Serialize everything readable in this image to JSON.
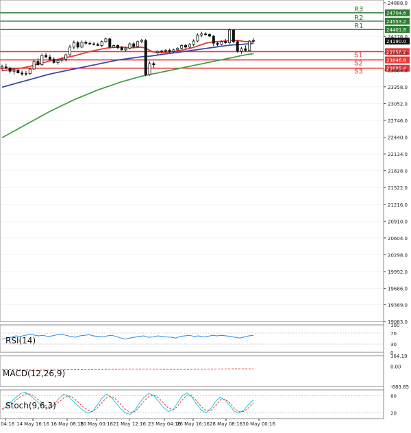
{
  "chart_data": [
    {
      "type": "candlestick",
      "panel": "price",
      "y_ticks": [
        24888.0,
        24276.0,
        23970.0,
        23664.0,
        23358.0,
        23052.0,
        22746.0,
        22440.0,
        22134.0,
        21828.0,
        21522.0,
        21216.0,
        20910.0,
        20604.0,
        20298.0,
        19992.0,
        19686.0,
        19389.0,
        19083.0
      ],
      "ylim": [
        19083.0,
        24888.0
      ],
      "x_tick_labels": [
        "y 04:16",
        "14 May 16:16",
        "16 May 08:16",
        "20 May 00:16",
        "21 May 12:16",
        "23 May 04:16",
        "26 May 16:16",
        "28 May 08:16",
        "30 May 00:16"
      ],
      "current_price": "24190.0",
      "resistance_levels": [
        {
          "label": "R3",
          "value": 24704.6,
          "text": "24704.6"
        },
        {
          "label": "R2",
          "value": 24553.2,
          "text": "24553.2"
        },
        {
          "label": "R1",
          "value": 24401.8,
          "text": "24401.8"
        }
      ],
      "support_levels": [
        {
          "label": "S1",
          "value": 23998.2,
          "text": "23998.2"
        },
        {
          "label": "S2",
          "value": 23846.8,
          "text": "23846.8"
        },
        {
          "label": "S3",
          "value": 23695.4,
          "text": "23695.4"
        }
      ],
      "candles": [
        [
          23700,
          23760,
          23650,
          23720
        ],
        [
          23720,
          23780,
          23680,
          23700
        ],
        [
          23700,
          23720,
          23600,
          23640
        ],
        [
          23640,
          23700,
          23580,
          23660
        ],
        [
          23660,
          23690,
          23600,
          23610
        ],
        [
          23610,
          23650,
          23560,
          23590
        ],
        [
          23590,
          23640,
          23560,
          23600
        ],
        [
          23600,
          23700,
          23580,
          23680
        ],
        [
          23680,
          23860,
          23660,
          23820
        ],
        [
          23820,
          23880,
          23740,
          23760
        ],
        [
          23760,
          23960,
          23740,
          23930
        ],
        [
          23930,
          23970,
          23880,
          23900
        ],
        [
          23900,
          23940,
          23840,
          23860
        ],
        [
          23860,
          23900,
          23780,
          23800
        ],
        [
          23800,
          23860,
          23760,
          23840
        ],
        [
          23840,
          23900,
          23800,
          23860
        ],
        [
          23860,
          23960,
          23820,
          23940
        ],
        [
          23940,
          24120,
          23920,
          24080
        ],
        [
          24080,
          24200,
          24040,
          24160
        ],
        [
          24160,
          24190,
          24050,
          24080
        ],
        [
          24080,
          24200,
          24060,
          24170
        ],
        [
          24170,
          24200,
          24120,
          24150
        ],
        [
          24150,
          24180,
          24120,
          24140
        ],
        [
          24140,
          24170,
          24110,
          24130
        ],
        [
          24130,
          24160,
          24100,
          24110
        ],
        [
          24110,
          24200,
          24080,
          24180
        ],
        [
          24180,
          24250,
          24160,
          24230
        ],
        [
          24230,
          24250,
          24050,
          24080
        ],
        [
          24080,
          24130,
          24060,
          24110
        ],
        [
          24110,
          24130,
          24040,
          24070
        ],
        [
          24070,
          24100,
          24020,
          24030
        ],
        [
          24030,
          24080,
          24000,
          24060
        ],
        [
          24060,
          24160,
          24040,
          24140
        ],
        [
          24140,
          24170,
          24060,
          24090
        ],
        [
          24090,
          24200,
          24070,
          24180
        ],
        [
          24180,
          24230,
          24150,
          24200
        ],
        [
          24200,
          24230,
          23550,
          23580
        ],
        [
          23580,
          23820,
          23560,
          23780
        ],
        [
          23780,
          23820,
          23700,
          23760
        ],
        [
          23980,
          24020,
          23940,
          24000
        ],
        [
          24000,
          24030,
          23970,
          24010
        ],
        [
          24010,
          24040,
          23980,
          24020
        ],
        [
          24020,
          24050,
          23980,
          24000
        ],
        [
          24000,
          24050,
          23980,
          24030
        ],
        [
          24030,
          24080,
          24000,
          24060
        ],
        [
          24060,
          24130,
          24040,
          24110
        ],
        [
          24110,
          24140,
          24050,
          24080
        ],
        [
          24080,
          24150,
          24060,
          24130
        ],
        [
          24130,
          24220,
          24100,
          24190
        ],
        [
          24190,
          24330,
          24170,
          24300
        ],
        [
          24300,
          24360,
          24260,
          24320
        ],
        [
          24320,
          24350,
          24290,
          24310
        ],
        [
          24310,
          24330,
          24260,
          24280
        ],
        [
          24280,
          24300,
          24100,
          24150
        ],
        [
          24150,
          24180,
          24100,
          24130
        ],
        [
          24130,
          24200,
          24110,
          24180
        ],
        [
          24180,
          24230,
          24140,
          24160
        ],
        [
          24160,
          24420,
          24140,
          24390
        ],
        [
          24390,
          24400,
          24150,
          24180
        ],
        [
          24180,
          24210,
          23980,
          24010
        ],
        [
          24010,
          24080,
          23960,
          24050
        ],
        [
          24050,
          24110,
          24000,
          24020
        ],
        [
          24020,
          24210,
          24000,
          24190
        ],
        [
          24190,
          24240,
          24160,
          24200
        ]
      ],
      "moving_averages": [
        {
          "color": "#e53935",
          "values": [
            23650,
            23660,
            23670,
            23680,
            23690,
            23700,
            23715,
            23730,
            23750,
            23770,
            23790,
            23810,
            23830,
            23845,
            23860,
            23875,
            23890,
            23905,
            23920,
            23940,
            23960,
            23980,
            24000,
            24015,
            24030,
            24045,
            24060,
            24070,
            24075,
            24080,
            24080,
            24075,
            24070,
            24070,
            24075,
            24080,
            24060,
            24020,
            23990,
            23980,
            23980,
            23985,
            23990,
            24000,
            24010,
            24025,
            24040,
            24055,
            24075,
            24100,
            24125,
            24150,
            24165,
            24175,
            24180,
            24185,
            24190,
            24200,
            24205,
            24200,
            24190,
            24180,
            24175,
            24175
          ]
        },
        {
          "color": "#3949ab",
          "values": [
            23350,
            23370,
            23390,
            23410,
            23430,
            23450,
            23470,
            23490,
            23510,
            23530,
            23550,
            23570,
            23590,
            23605,
            23620,
            23635,
            23650,
            23665,
            23680,
            23695,
            23710,
            23725,
            23740,
            23755,
            23770,
            23785,
            23800,
            23815,
            23830,
            23845,
            23855,
            23865,
            23875,
            23885,
            23895,
            23905,
            23910,
            23915,
            23925,
            23935,
            23945,
            23955,
            23965,
            23975,
            23985,
            23995,
            24005,
            24015,
            24025,
            24035,
            24045,
            24055,
            24065,
            24075,
            24085,
            24095,
            24105,
            24115,
            24120,
            24125,
            24130,
            24135,
            24140,
            24145
          ]
        },
        {
          "color": "#43a047",
          "values": [
            22430,
            22470,
            22510,
            22550,
            22590,
            22630,
            22670,
            22710,
            22750,
            22790,
            22830,
            22870,
            22910,
            22945,
            22980,
            23015,
            23050,
            23085,
            23120,
            23150,
            23180,
            23210,
            23240,
            23270,
            23300,
            23325,
            23350,
            23375,
            23400,
            23425,
            23450,
            23470,
            23490,
            23510,
            23530,
            23550,
            23565,
            23580,
            23595,
            23610,
            23625,
            23640,
            23655,
            23670,
            23685,
            23700,
            23715,
            23730,
            23745,
            23760,
            23775,
            23790,
            23805,
            23820,
            23835,
            23850,
            23865,
            23880,
            23895,
            23910,
            23925,
            23940,
            23950,
            23960
          ]
        }
      ]
    },
    {
      "type": "line",
      "panel": "RSI",
      "label": "RSI(14)",
      "y_ticks": [
        "100",
        "70",
        "30",
        "0"
      ],
      "ylim": [
        0,
        100
      ],
      "values": [
        48,
        52,
        55,
        60,
        58,
        62,
        65,
        63,
        60,
        62,
        58,
        60,
        64,
        66,
        62,
        58,
        55,
        60,
        62,
        64,
        60,
        58,
        56,
        60,
        62,
        58,
        52,
        48,
        52,
        55,
        58,
        60,
        55,
        56,
        60,
        58,
        56,
        55,
        52,
        58,
        60,
        62,
        58,
        60,
        56,
        58,
        62,
        60,
        62,
        60,
        58,
        55,
        52,
        56,
        60,
        62
      ],
      "color": "#1e88e5"
    },
    {
      "type": "bar",
      "panel": "MACD",
      "label": "MACD(12,26,9)",
      "y_ticks": [
        "364.19",
        "0.00",
        "-683.85"
      ],
      "ylim": [
        -683.85,
        364.19
      ],
      "signal_values": [
        -110,
        -112,
        -115,
        -118,
        -120,
        -122,
        -124,
        -125,
        -125,
        -124,
        -123,
        -122,
        -120,
        -118,
        -116,
        -115,
        -114,
        -112,
        -110,
        -108,
        -106,
        -104,
        -102,
        -100,
        -98,
        -96,
        -95,
        -94,
        -93,
        -92,
        -92,
        -93,
        -95,
        -98,
        -100,
        -102,
        -104,
        -105,
        -104,
        -102,
        -100,
        -98,
        -96,
        -94,
        -92,
        -90,
        -88,
        -86,
        -84,
        -82,
        -80,
        -80,
        -82,
        -85
      ],
      "signal_color": "#e53935"
    },
    {
      "type": "line",
      "panel": "Stochastic",
      "label": "Stoch(9,6,3)",
      "y_ticks": [
        "80",
        "20"
      ],
      "ylim": [
        0,
        100
      ],
      "series": [
        {
          "color": "#26c6da",
          "values": [
            30,
            45,
            60,
            75,
            88,
            92,
            80,
            65,
            50,
            40,
            35,
            50,
            70,
            85,
            78,
            60,
            45,
            30,
            20,
            25,
            45,
            70,
            85,
            75,
            55,
            35,
            20,
            15,
            30,
            55,
            75,
            88,
            80,
            60,
            40,
            25,
            30,
            55,
            80,
            90,
            75,
            50,
            30,
            20,
            35,
            60,
            75,
            65,
            45,
            25,
            20,
            30,
            50,
            65
          ]
        },
        {
          "color": "#e53935",
          "dashed": true,
          "values": [
            35,
            40,
            52,
            65,
            78,
            86,
            85,
            75,
            60,
            48,
            40,
            45,
            58,
            72,
            80,
            72,
            58,
            42,
            30,
            24,
            35,
            55,
            72,
            78,
            68,
            50,
            32,
            22,
            25,
            42,
            62,
            78,
            82,
            72,
            55,
            38,
            30,
            42,
            65,
            82,
            80,
            62,
            42,
            28,
            28,
            45,
            65,
            68,
            55,
            35,
            24,
            25,
            38,
            55
          ]
        }
      ]
    }
  ]
}
